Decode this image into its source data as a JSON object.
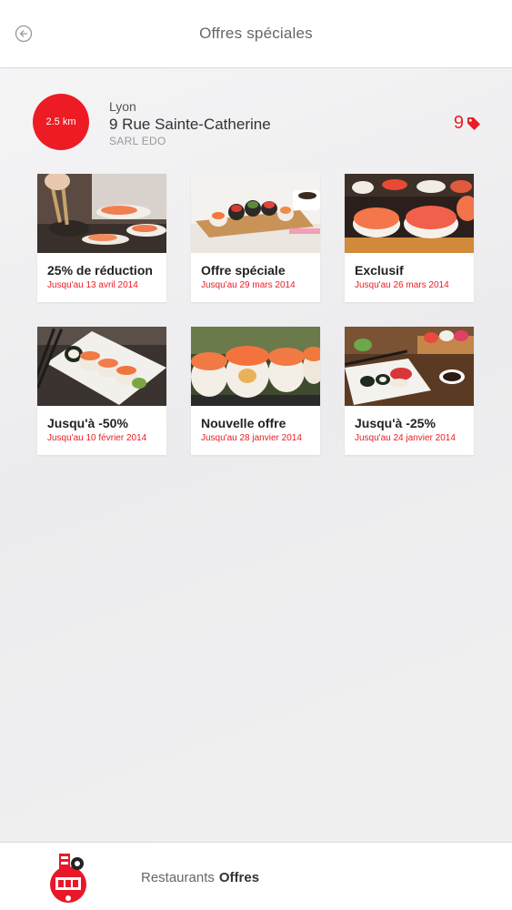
{
  "header": {
    "title": "Offres spéciales"
  },
  "location": {
    "distance": "2.5 km",
    "city": "Lyon",
    "street": "9 Rue Sainte-Catherine",
    "company": "SARL EDO",
    "offer_count": "9"
  },
  "offers": [
    {
      "title": "25% de réduction",
      "date": "Jusqu'au 13 avril 2014"
    },
    {
      "title": "Offre spéciale",
      "date": "Jusqu'au 29 mars 2014"
    },
    {
      "title": "Exclusif",
      "date": "Jusqu'au 26 mars 2014"
    },
    {
      "title": "Jusqu'à -50%",
      "date": "Jusqu'au 10 février 2014"
    },
    {
      "title": "Nouvelle offre",
      "date": "Jusqu'au 28 janvier 2014"
    },
    {
      "title": "Jusqu'à -25%",
      "date": "Jusqu'au 24 janvier 2014"
    }
  ],
  "footer": {
    "tab_restaurants": "Restaurants",
    "tab_offres": "Offres"
  },
  "colors": {
    "accent": "#ed1c24"
  },
  "icons": {
    "back": "back-arrow-icon",
    "tag": "tag-icon",
    "logo": "restaurant-logo"
  }
}
